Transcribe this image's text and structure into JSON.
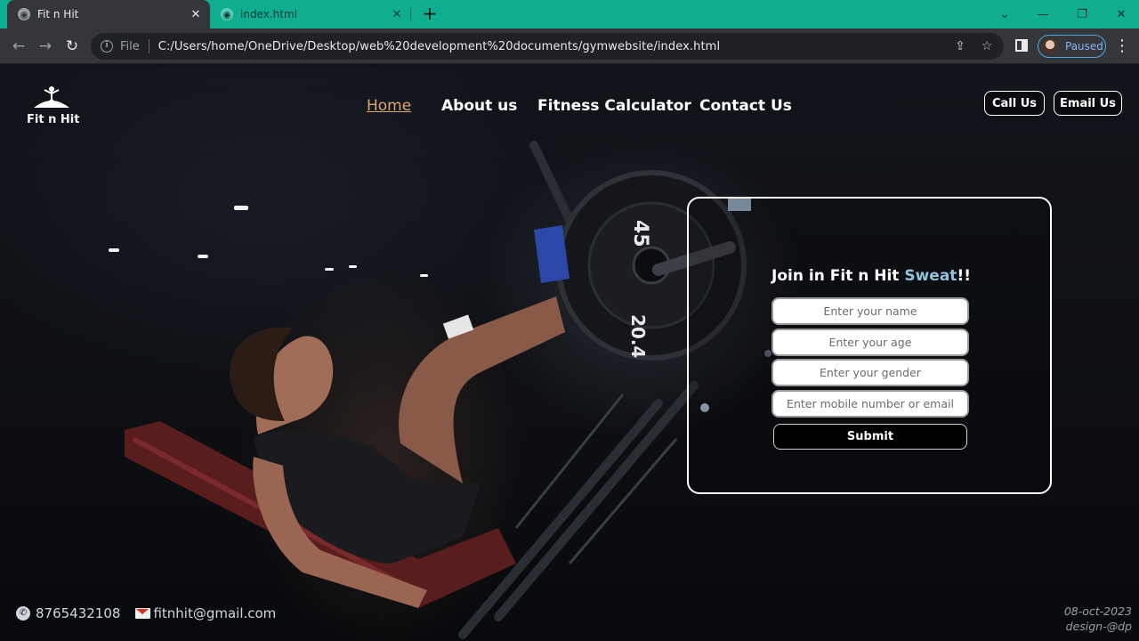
{
  "browser": {
    "tabs": [
      {
        "title": "Fit n Hit",
        "active": true
      },
      {
        "title": "index.html",
        "active": false
      }
    ],
    "address": {
      "scheme_label": "File",
      "url": "C:/Users/home/OneDrive/Desktop/web%20development%20documents/gymwebsite/index.html"
    },
    "profile_label": "Paused",
    "colors": {
      "tab_strip": "#0fae91",
      "toolbar": "#35363a",
      "omnibox": "#202124"
    }
  },
  "site": {
    "logo_text": "Fit n Hit",
    "nav": [
      {
        "label": "Home",
        "active": true
      },
      {
        "label": "About us",
        "active": false
      },
      {
        "label": "Fitness Calculator",
        "active": false
      },
      {
        "label": "Contact Us",
        "active": false
      }
    ],
    "cta": {
      "call": "Call Us",
      "email": "Email Us"
    },
    "form": {
      "title_prefix": "Join in Fit n Hit ",
      "title_accent": "Sweat",
      "title_suffix": "!!",
      "fields": [
        {
          "placeholder": "Enter your name"
        },
        {
          "placeholder": "Enter your age"
        },
        {
          "placeholder": "Enter your gender"
        },
        {
          "placeholder": "Enter mobile number or email"
        }
      ],
      "submit_label": "Submit"
    },
    "footer": {
      "phone": "8765432108",
      "email": "fitnhit@gmail.com",
      "date": "08-oct-2023",
      "credit": "design-@dp"
    },
    "colors": {
      "nav_active": "#e0a56a",
      "title_accent": "#8fc3dc",
      "text": "#ffffff"
    }
  }
}
